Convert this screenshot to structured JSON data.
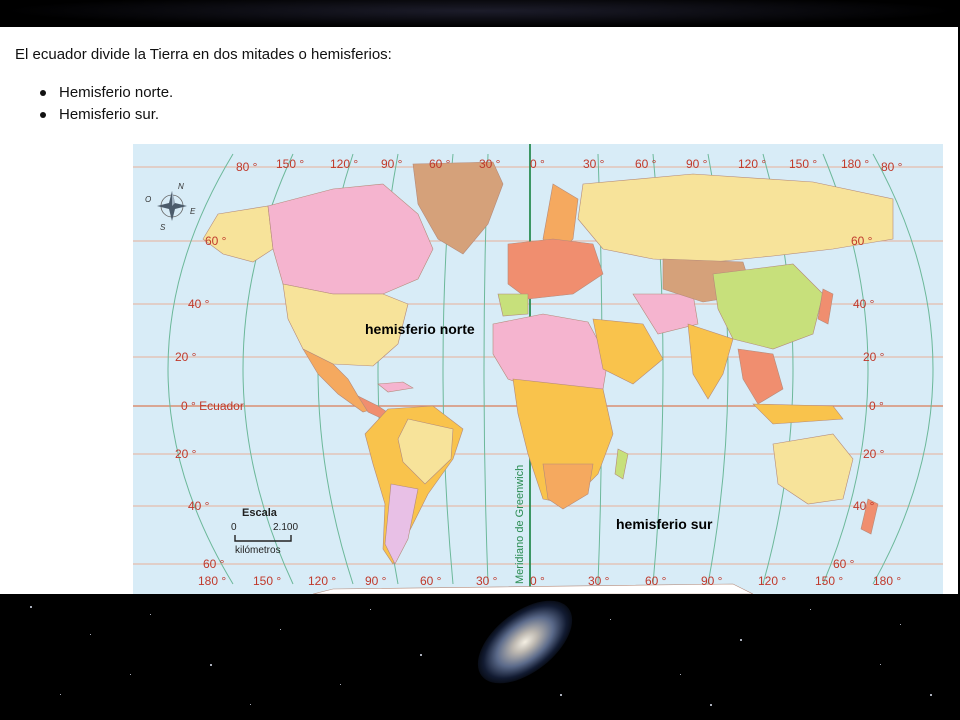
{
  "slide": {
    "intro": "El ecuador divide la Tierra en dos mitades o hemisferios:",
    "bullets": [
      "Hemisferio norte.",
      "Hemisferio sur."
    ]
  },
  "map": {
    "top_longitudes": [
      "150 °",
      "120 °",
      "90 °",
      "60 °",
      "30 °",
      "0 °",
      "30 °",
      "60 °",
      "90 °",
      "120 °",
      "150 °",
      "180 °"
    ],
    "bottom_longitudes": [
      "180 °",
      "150 °",
      "120 °",
      "90 °",
      "60 °",
      "30 °",
      "0 °",
      "30 °",
      "60 °",
      "90 °",
      "120 °",
      "150 °",
      "180 °"
    ],
    "left_latitudes": [
      "80 °",
      "60 °",
      "40 °",
      "20 °",
      "0 ° Ecuador",
      "20 °",
      "40 °",
      "60 °"
    ],
    "right_latitudes": [
      "80 °",
      "60 °",
      "40 °",
      "20 °",
      "0 °",
      "20 °",
      "40 °",
      "60 °"
    ],
    "hemisphere_north": "hemisferio norte",
    "hemisphere_south": "hemisferio sur",
    "meridian_label": "Meridiano de Greenwich",
    "compass": {
      "n": "N",
      "s": "S",
      "e": "E",
      "o": "O"
    },
    "scale": {
      "title": "Escala",
      "min": "0",
      "max": "2.100",
      "unit": "kilómetros"
    },
    "colors": {
      "ocean": "#d8ecf7",
      "graticule_lat": "#e8b09a",
      "graticule_lon": "#6cb89a",
      "greenwich": "#2a8c52",
      "label": "#c0392b"
    }
  }
}
